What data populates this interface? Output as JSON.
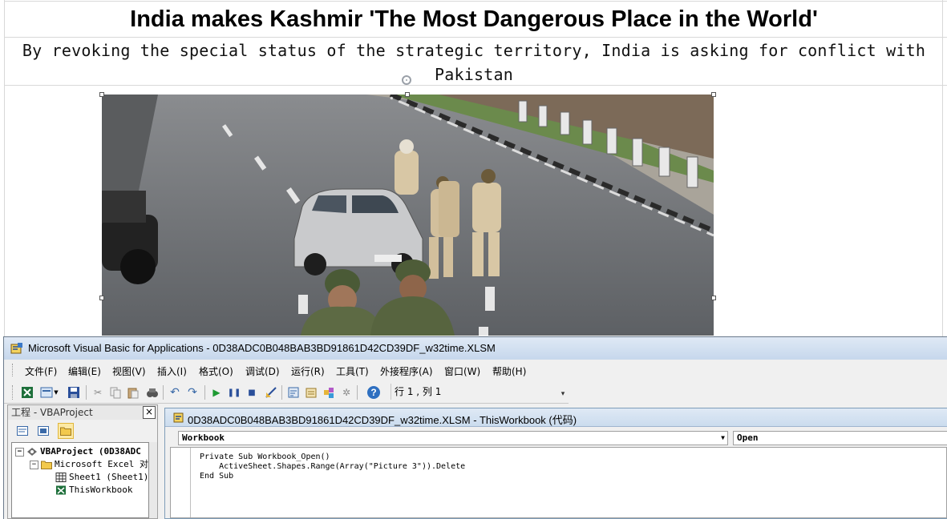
{
  "sheet": {
    "headline": "India makes Kashmir 'The Most Dangerous Place in the World'",
    "subheadline": "By revoking the special status of the strategic territory, India is asking for conflict with Pakistan"
  },
  "picture": {
    "description_icon": "photo-kashmir-soldiers"
  },
  "vba": {
    "title": "Microsoft Visual Basic for Applications - 0D38ADC0B048BAB3BD91861D42CD39DF_w32time.XLSM",
    "menu": [
      "文件(F)",
      "编辑(E)",
      "视图(V)",
      "插入(I)",
      "格式(O)",
      "调试(D)",
      "运行(R)",
      "工具(T)",
      "外接程序(A)",
      "窗口(W)",
      "帮助(H)"
    ],
    "cursor_position": "行 1 , 列 1",
    "project": {
      "title": "工程 - VBAProject",
      "close": "×",
      "tree": [
        {
          "label": "VBAProject (0D38ADC"
        },
        {
          "label": "Microsoft Excel 对象"
        },
        {
          "label": "Sheet1 (Sheet1)"
        },
        {
          "label": "ThisWorkbook"
        }
      ]
    },
    "code_window": {
      "title": "0D38ADC0B048BAB3BD91861D42CD39DF_w32time.XLSM - ThisWorkbook (代码)",
      "object_combo": "Workbook",
      "procedure_combo": "Open",
      "code": [
        "Private Sub Workbook_Open()",
        "    ActiveSheet.Shapes.Range(Array(\"Picture 3\")).Delete",
        "End Sub"
      ]
    }
  }
}
